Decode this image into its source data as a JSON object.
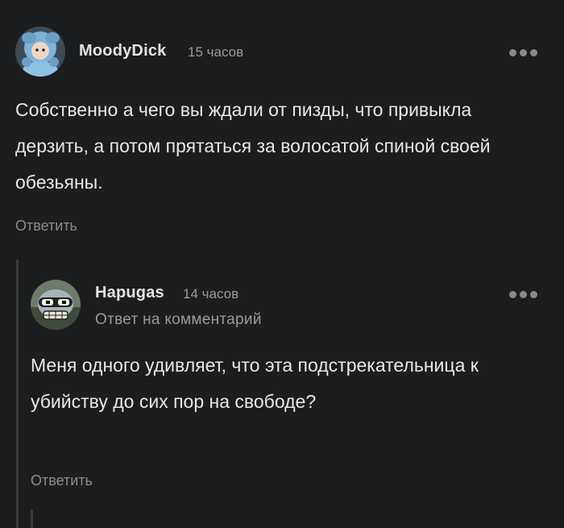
{
  "comments": [
    {
      "username": "MoodyDick",
      "time": "15 часов",
      "text": "Собственно а чего вы ждали от пизды, что привыкла дерзить, а потом прятаться за волосатой спиной своей обезьяны.",
      "reply_label": "Ответить",
      "avatar_icon": "blue-creature-avatar"
    },
    {
      "username": "Hapugas",
      "time": "14 часов",
      "subline": "Ответ на комментарий",
      "text": "Меня одного удивляет, что эта подстрекательница к убийству до сих пор на свободе?",
      "reply_label": "Ответить",
      "avatar_icon": "robot-avatar"
    }
  ],
  "more_icon": "ellipsis-icon",
  "colors": {
    "background": "#1c1d1f",
    "text": "#e8e8e8",
    "muted": "#8c8c8c",
    "thread_line": "#3a3b3d"
  }
}
